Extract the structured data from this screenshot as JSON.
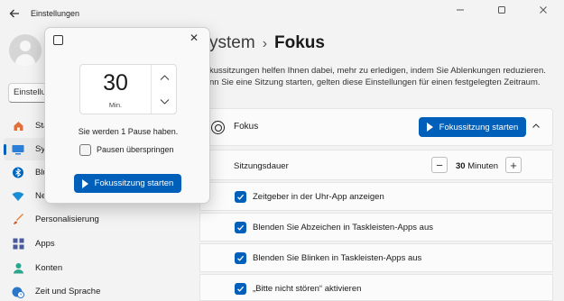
{
  "titlebar": {
    "back_icon": "arrow-left-icon",
    "title": "Einstellungen",
    "controls": [
      "minimize-icon",
      "maximize-icon",
      "close-icon"
    ]
  },
  "sidebar": {
    "search_value": "Einstellun",
    "items": [
      {
        "label": "Sta",
        "icon": "home-icon",
        "color": "#e0703a"
      },
      {
        "label": "Sys",
        "icon": "system-icon",
        "color": "#2b7fd6",
        "selected": true
      },
      {
        "label": "Blu",
        "icon": "bluetooth-icon",
        "color": "#0067c0"
      },
      {
        "label": "Ne",
        "icon": "wifi-icon",
        "color": "#1a8ed4"
      },
      {
        "label": "Personalisierung",
        "icon": "brush-icon",
        "color": "#e3833b"
      },
      {
        "label": "Apps",
        "icon": "apps-icon",
        "color": "#4a5a9c"
      },
      {
        "label": "Konten",
        "icon": "accounts-icon",
        "color": "#2ca58d"
      },
      {
        "label": "Zeit und Sprache",
        "icon": "globe-clock-icon",
        "color": "#2a76c9"
      }
    ]
  },
  "main": {
    "breadcrumb_parent": "ystem",
    "breadcrumb_separator": "›",
    "page_title": "Fokus",
    "description_line1": "kussitzungen helfen Ihnen dabei, mehr zu erledigen, indem Sie Ablenkungen reduzieren.",
    "description_line2": "nn Sie eine Sitzung starten, gelten diese Einstellungen für einen festgelegten Zeitraum.",
    "card": {
      "title": "Fokus",
      "start_button": "Fokussitzung starten",
      "expand_icon": "chevron-up-icon"
    },
    "duration": {
      "label": "Sitzungsdauer",
      "minus": "−",
      "value": "30",
      "unit": "Minuten",
      "plus": "+"
    },
    "options": [
      {
        "label": "Zeitgeber in der Uhr-App anzeigen",
        "checked": true
      },
      {
        "label": "Blenden Sie Abzeichen in Taskleisten-Apps aus",
        "checked": true
      },
      {
        "label": "Blenden Sie Blinken in Taskleisten-Apps aus",
        "checked": true
      },
      {
        "label": "„Bitte nicht stören“ aktivieren",
        "checked": true
      }
    ]
  },
  "flyout": {
    "icon": "focus-window-icon",
    "close": "✕",
    "timer_value": "30",
    "timer_unit": "Min.",
    "breaks_text": "Sie werden 1 Pause haben.",
    "skip_breaks_label": "Pausen überspringen",
    "skip_breaks_checked": false,
    "start_button": "Fokussitzung starten"
  },
  "colors": {
    "accent": "#005fb8",
    "background": "#f3f3f3",
    "card": "#fbfbfb"
  }
}
